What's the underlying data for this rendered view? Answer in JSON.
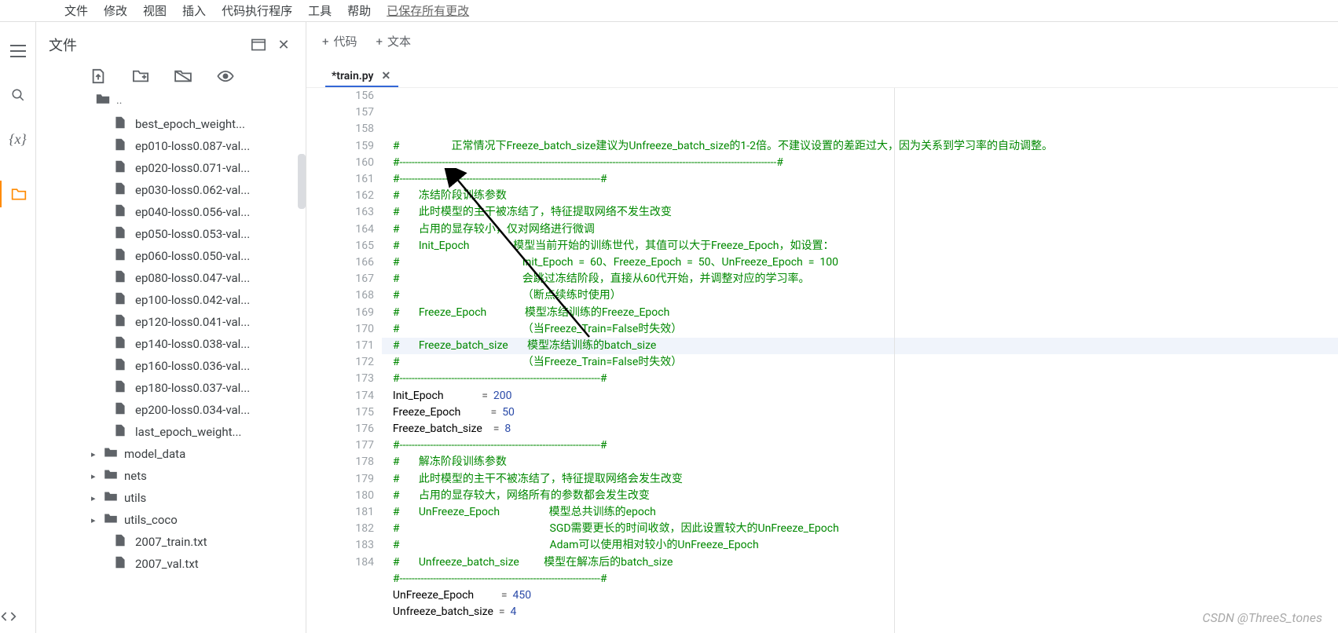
{
  "menubar": {
    "items": [
      "文件",
      "修改",
      "视图",
      "插入",
      "代码执行程序",
      "工具",
      "帮助"
    ],
    "saved": "已保存所有更改"
  },
  "filepanel": {
    "title": "文件",
    "up_label": ".."
  },
  "files": [
    {
      "type": "file",
      "name": "best_epoch_weight..."
    },
    {
      "type": "file",
      "name": "ep010-loss0.087-val..."
    },
    {
      "type": "file",
      "name": "ep020-loss0.071-val..."
    },
    {
      "type": "file",
      "name": "ep030-loss0.062-val..."
    },
    {
      "type": "file",
      "name": "ep040-loss0.056-val..."
    },
    {
      "type": "file",
      "name": "ep050-loss0.053-val..."
    },
    {
      "type": "file",
      "name": "ep060-loss0.050-val..."
    },
    {
      "type": "file",
      "name": "ep080-loss0.047-val..."
    },
    {
      "type": "file",
      "name": "ep100-loss0.042-val..."
    },
    {
      "type": "file",
      "name": "ep120-loss0.041-val..."
    },
    {
      "type": "file",
      "name": "ep140-loss0.038-val..."
    },
    {
      "type": "file",
      "name": "ep160-loss0.036-val..."
    },
    {
      "type": "file",
      "name": "ep180-loss0.037-val..."
    },
    {
      "type": "file",
      "name": "ep200-loss0.034-val..."
    },
    {
      "type": "file",
      "name": "last_epoch_weight..."
    },
    {
      "type": "folder",
      "name": "model_data"
    },
    {
      "type": "folder",
      "name": "nets"
    },
    {
      "type": "folder",
      "name": "utils"
    },
    {
      "type": "folder",
      "name": "utils_coco"
    },
    {
      "type": "file",
      "name": "2007_train.txt"
    },
    {
      "type": "file",
      "name": "2007_val.txt"
    }
  ],
  "editor": {
    "toolbar": {
      "code": "代码",
      "text": "文本"
    },
    "tab": "*train.py",
    "first_line": 156,
    "highlight_line": 171,
    "lines": [
      {
        "t": "#                   正常情况下Freeze_batch_size建议为Unfreeze_batch_size的1-2倍。不建议设置的差距过大，因为关系到学习率的自动调整。",
        "cls": "c"
      },
      {
        "t": "#----------------------------------------------------------------------------------------------------------------------------#",
        "cls": "c"
      },
      {
        "t": "#------------------------------------------------------------------#",
        "cls": "c"
      },
      {
        "t": "#       冻结阶段训练参数",
        "cls": "c"
      },
      {
        "t": "#       此时模型的主干被冻结了，特征提取网络不发生改变",
        "cls": "c"
      },
      {
        "t": "#       占用的显存较小，仅对网络进行微调",
        "cls": "c"
      },
      {
        "t": "#       Init_Epoch                模型当前开始的训练世代，其值可以大于Freeze_Epoch，如设置：",
        "cls": "c"
      },
      {
        "t": "#                                             Init_Epoch  =  60、Freeze_Epoch  =  50、UnFreeze_Epoch  =  100",
        "cls": "c"
      },
      {
        "t": "#                                             会跳过冻结阶段，直接从60代开始，并调整对应的学习率。",
        "cls": "c"
      },
      {
        "t": "#                                             （断点续练时使用）",
        "cls": "c"
      },
      {
        "t": "#       Freeze_Epoch              模型冻结训练的Freeze_Epoch",
        "cls": "c"
      },
      {
        "t": "#                                             （当Freeze_Train=False时失效）",
        "cls": "c"
      },
      {
        "t": "#       Freeze_batch_size       模型冻结训练的batch_size",
        "cls": "c"
      },
      {
        "t": "#                                             （当Freeze_Train=False时失效）",
        "cls": "c"
      },
      {
        "t": "#------------------------------------------------------------------#",
        "cls": "c"
      },
      {
        "raw": [
          "Init_Epoch",
          null,
          "              ",
          "=",
          "  ",
          "200"
        ]
      },
      {
        "raw": [
          "Freeze_Epoch",
          null,
          "           ",
          "=",
          "  ",
          "50"
        ]
      },
      {
        "raw": [
          "Freeze_batch_size",
          null,
          "    ",
          "=",
          "  ",
          "8"
        ]
      },
      {
        "t": "#------------------------------------------------------------------#",
        "cls": "c"
      },
      {
        "t": "#       解冻阶段训练参数",
        "cls": "c"
      },
      {
        "t": "#       此时模型的主干不被冻结了，特征提取网络会发生改变",
        "cls": "c"
      },
      {
        "t": "#       占用的显存较大，网络所有的参数都会发生改变",
        "cls": "c"
      },
      {
        "t": "#       UnFreeze_Epoch                  模型总共训练的epoch",
        "cls": "c"
      },
      {
        "t": "#                                                       SGD需要更长的时间收敛，因此设置较大的UnFreeze_Epoch",
        "cls": "c"
      },
      {
        "t": "#                                                       Adam可以使用相对较小的UnFreeze_Epoch",
        "cls": "c"
      },
      {
        "t": "#       Unfreeze_batch_size         模型在解冻后的batch_size",
        "cls": "c"
      },
      {
        "t": "#------------------------------------------------------------------#",
        "cls": "c"
      },
      {
        "raw": [
          "UnFreeze_Epoch",
          null,
          "          ",
          "=",
          "  ",
          "450"
        ]
      },
      {
        "raw": [
          "Unfreeze_batch_size",
          null,
          "  ",
          "=",
          "  ",
          "4"
        ]
      }
    ]
  },
  "watermark": "CSDN @ThreeS_tones"
}
